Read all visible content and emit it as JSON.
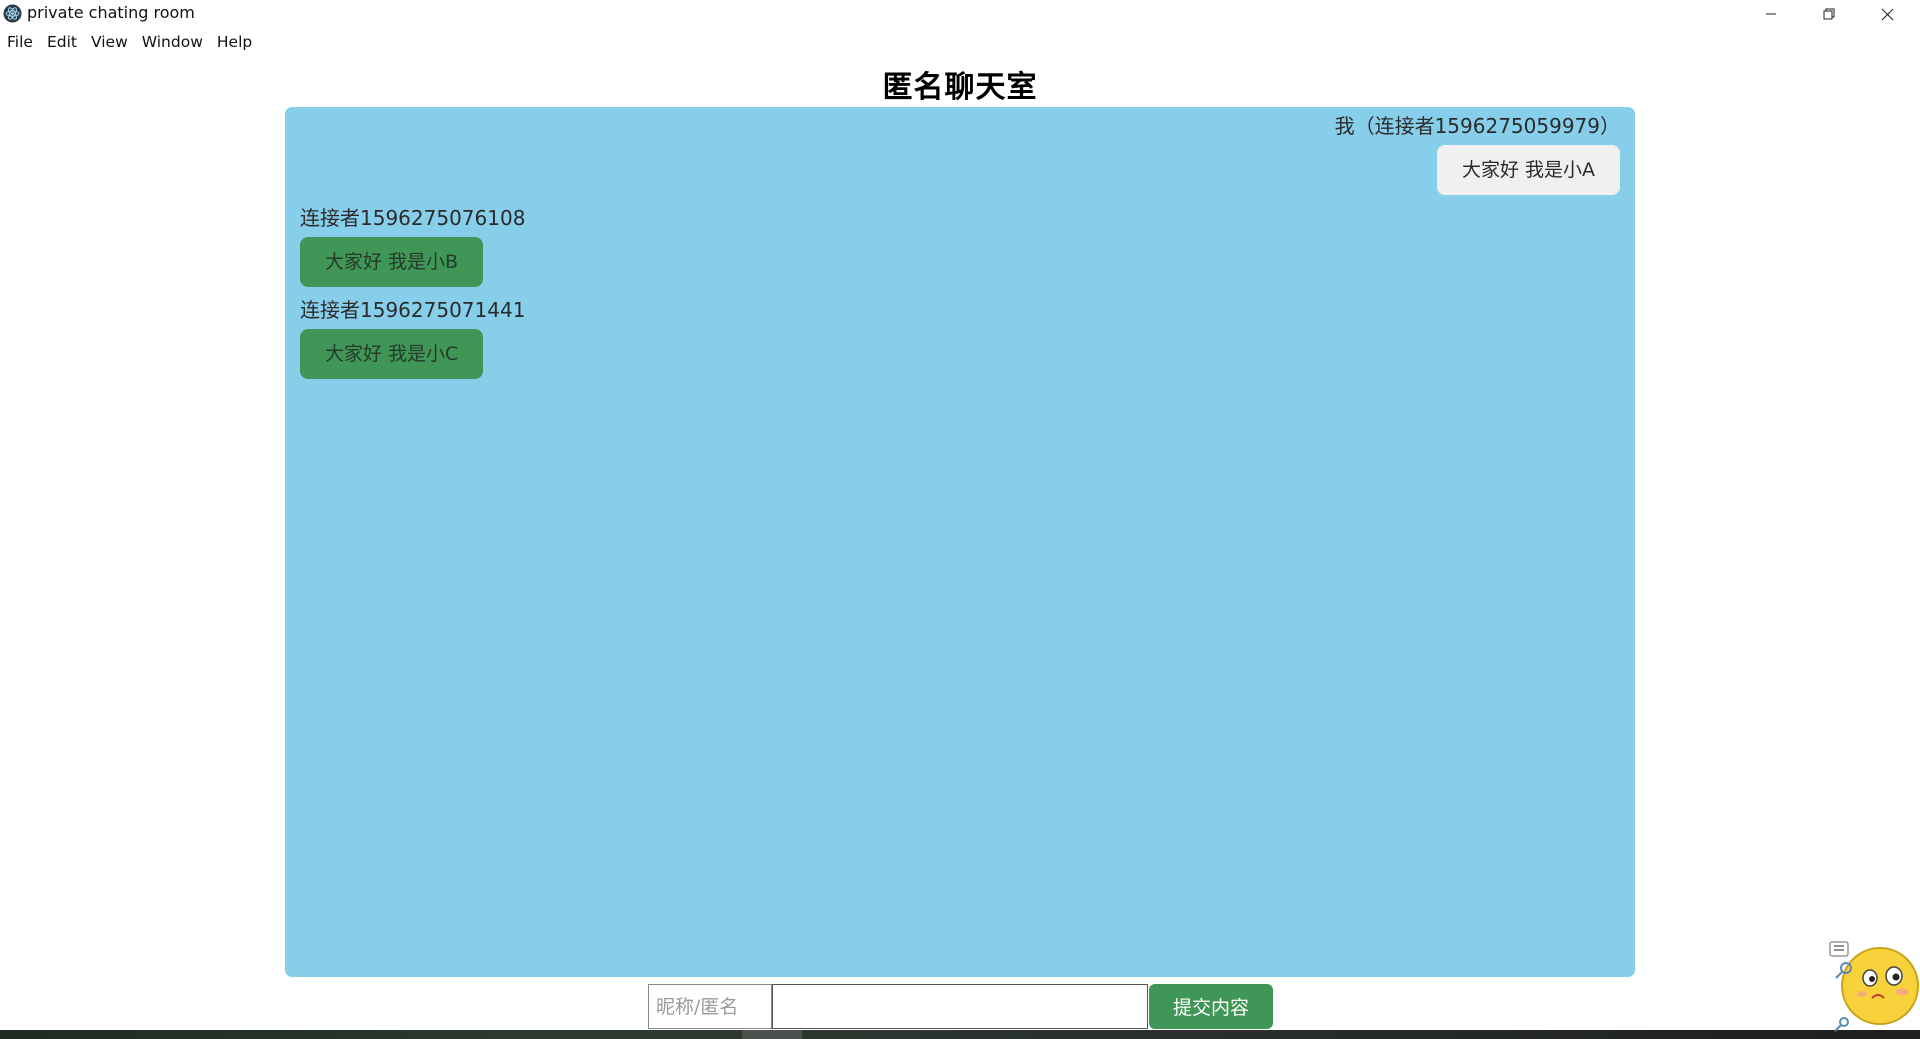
{
  "window": {
    "title": "private chating room"
  },
  "menu": {
    "items": [
      "File",
      "Edit",
      "View",
      "Window",
      "Help"
    ]
  },
  "page": {
    "heading": "匿名聊天室"
  },
  "messages": [
    {
      "sender": "我（连接者1596275059979）",
      "text": "大家好 我是小A",
      "self": true
    },
    {
      "sender": "连接者1596275076108",
      "text": "大家好 我是小B",
      "self": false
    },
    {
      "sender": "连接者1596275071441",
      "text": "大家好 我是小C",
      "self": false
    }
  ],
  "composer": {
    "nickname_placeholder": "昵称/匿名",
    "nickname_value": "",
    "message_value": "",
    "submit_label": "提交内容"
  },
  "colors": {
    "chat_panel_bg": "#87ceeb",
    "other_bubble_bg": "#3f9657",
    "self_bubble_bg": "#f0f0f0",
    "submit_button_bg": "#3f9657"
  },
  "icons": {
    "app": "electron-atom-icon",
    "minimize": "minimize-icon",
    "maximize": "restore-icon",
    "close": "close-icon",
    "ime": "ime-mascot-icon"
  }
}
